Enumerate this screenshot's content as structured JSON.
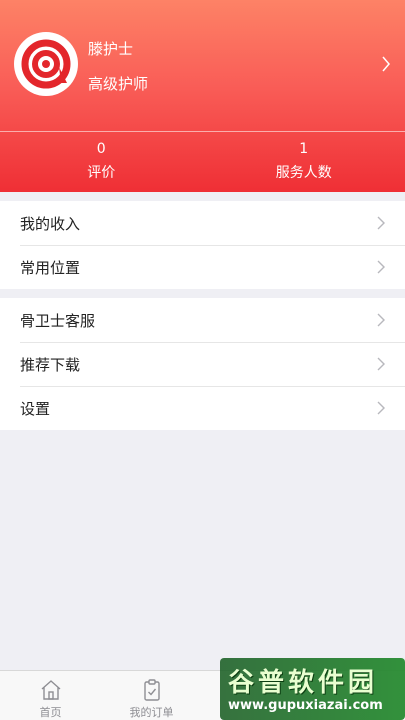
{
  "profile": {
    "name": "滕护士",
    "title": "高级护师"
  },
  "stats": [
    {
      "value": "0",
      "label": "评价"
    },
    {
      "value": "1",
      "label": "服务人数"
    }
  ],
  "menu_group_1": [
    {
      "label": "我的收入"
    },
    {
      "label": "常用位置"
    }
  ],
  "menu_group_2": [
    {
      "label": "骨卫士客服"
    },
    {
      "label": "推荐下载"
    },
    {
      "label": "设置"
    }
  ],
  "tabbar": [
    {
      "label": "首页",
      "icon": "home-icon"
    },
    {
      "label": "我的订单",
      "icon": "order-icon"
    }
  ],
  "watermark": {
    "main": "谷普软件园",
    "url": "www.gupuxiazai.com"
  },
  "colors": {
    "header_top": "#fd8266",
    "header_bottom": "#ef2f35",
    "background": "#efeff4"
  }
}
